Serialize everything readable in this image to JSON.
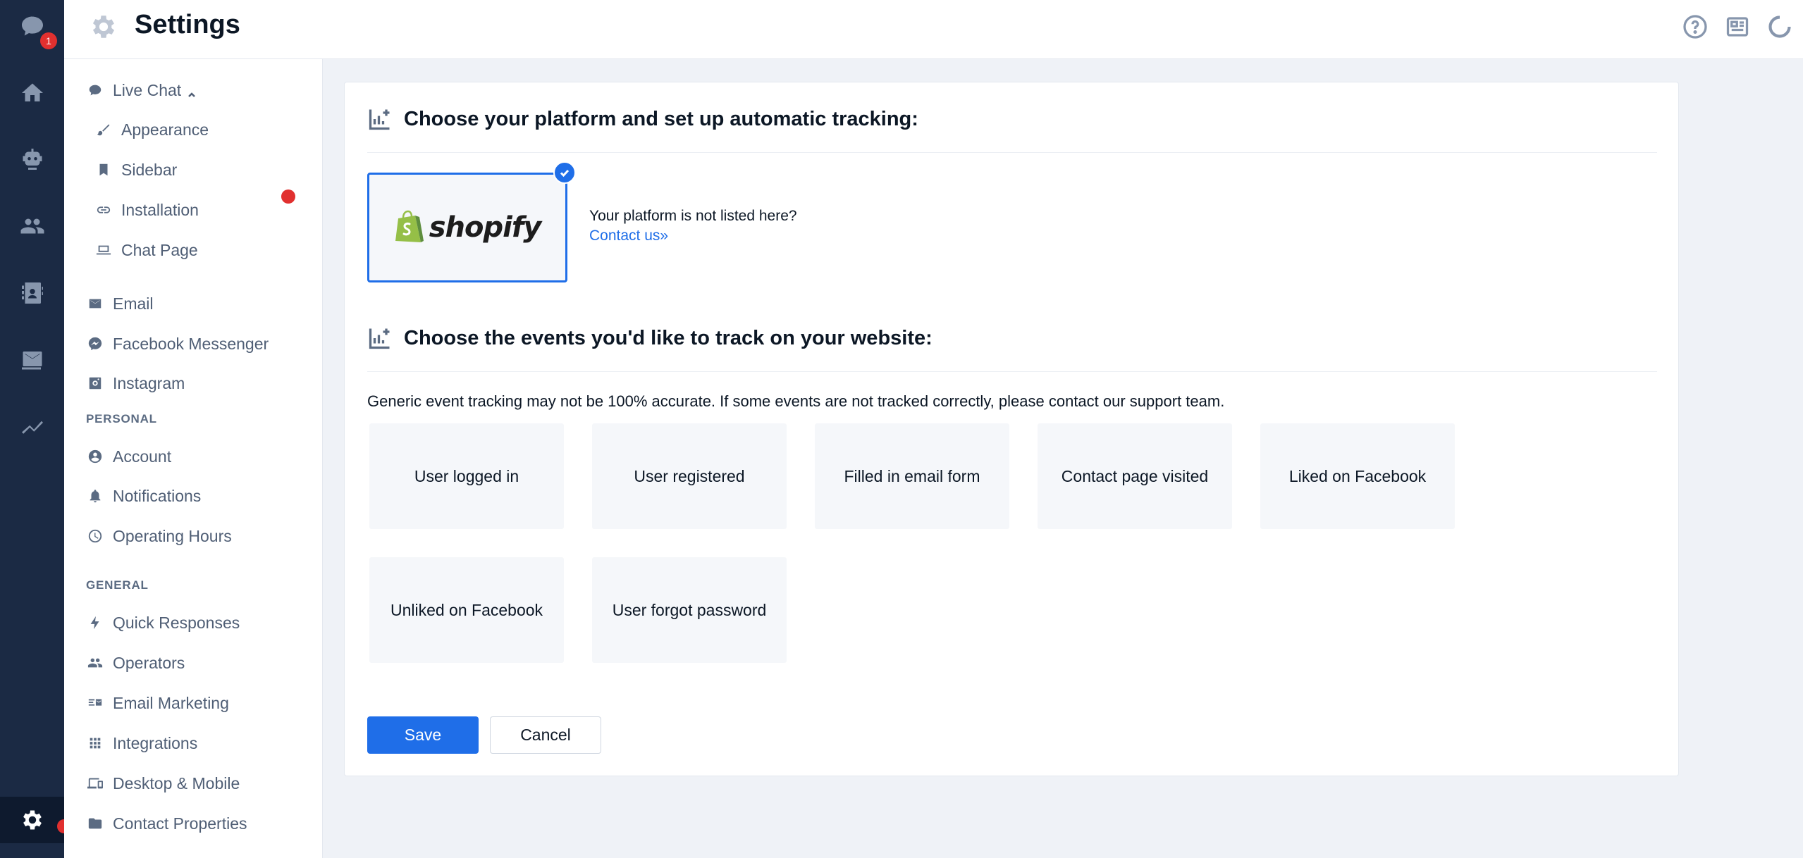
{
  "rail": {
    "chat_badge": "1",
    "items": [
      {
        "name": "chat-icon"
      },
      {
        "name": "home-icon"
      },
      {
        "name": "bot-icon"
      },
      {
        "name": "visitors-icon"
      },
      {
        "name": "contacts-icon"
      },
      {
        "name": "inbox-icon"
      },
      {
        "name": "analytics-icon"
      },
      {
        "name": "settings-icon",
        "active": true
      }
    ]
  },
  "header": {
    "title": "Settings",
    "icons": [
      "help-icon",
      "news-icon",
      "loading-icon"
    ]
  },
  "sidebar": {
    "live_chat": {
      "label": "Live Chat",
      "children": [
        {
          "label": "Appearance",
          "icon": "brush-icon"
        },
        {
          "label": "Sidebar",
          "icon": "bookmark-icon"
        },
        {
          "label": "Installation",
          "icon": "link-icon",
          "alert": true
        },
        {
          "label": "Chat Page",
          "icon": "laptop-icon"
        }
      ]
    },
    "channels": [
      {
        "label": "Email",
        "icon": "email-icon"
      },
      {
        "label": "Facebook Messenger",
        "icon": "messenger-icon"
      },
      {
        "label": "Instagram",
        "icon": "instagram-icon"
      }
    ],
    "personal": {
      "heading": "PERSONAL",
      "items": [
        {
          "label": "Account",
          "icon": "account-icon"
        },
        {
          "label": "Notifications",
          "icon": "bell-icon"
        },
        {
          "label": "Operating Hours",
          "icon": "clock-icon"
        }
      ]
    },
    "general": {
      "heading": "GENERAL",
      "items": [
        {
          "label": "Quick Responses",
          "icon": "bolt-icon"
        },
        {
          "label": "Operators",
          "icon": "operators-icon"
        },
        {
          "label": "Email Marketing",
          "icon": "email-marketing-icon"
        },
        {
          "label": "Integrations",
          "icon": "grid-icon"
        },
        {
          "label": "Desktop & Mobile",
          "icon": "devices-icon"
        },
        {
          "label": "Contact Properties",
          "icon": "folder-icon"
        }
      ]
    }
  },
  "main": {
    "platform_section": {
      "title": "Choose your platform and set up automatic tracking:",
      "platform_name": "shopify",
      "not_listed": "Your platform is not listed here?",
      "contact_link": "Contact us»"
    },
    "events_section": {
      "title": "Choose the events you'd like to track on your website:",
      "note": "Generic event tracking may not be 100% accurate. If some events are not tracked correctly, please contact our support team.",
      "events": [
        "User logged in",
        "User registered",
        "Filled in email form",
        "Contact page visited",
        "Liked on Facebook",
        "Unliked on Facebook",
        "User forgot password"
      ]
    },
    "actions": {
      "save": "Save",
      "cancel": "Cancel"
    }
  },
  "colors": {
    "accent": "#1f6ee8",
    "rail_bg": "#1b2a44",
    "alert": "#e1302f",
    "shopify_green": "#95bf47"
  }
}
